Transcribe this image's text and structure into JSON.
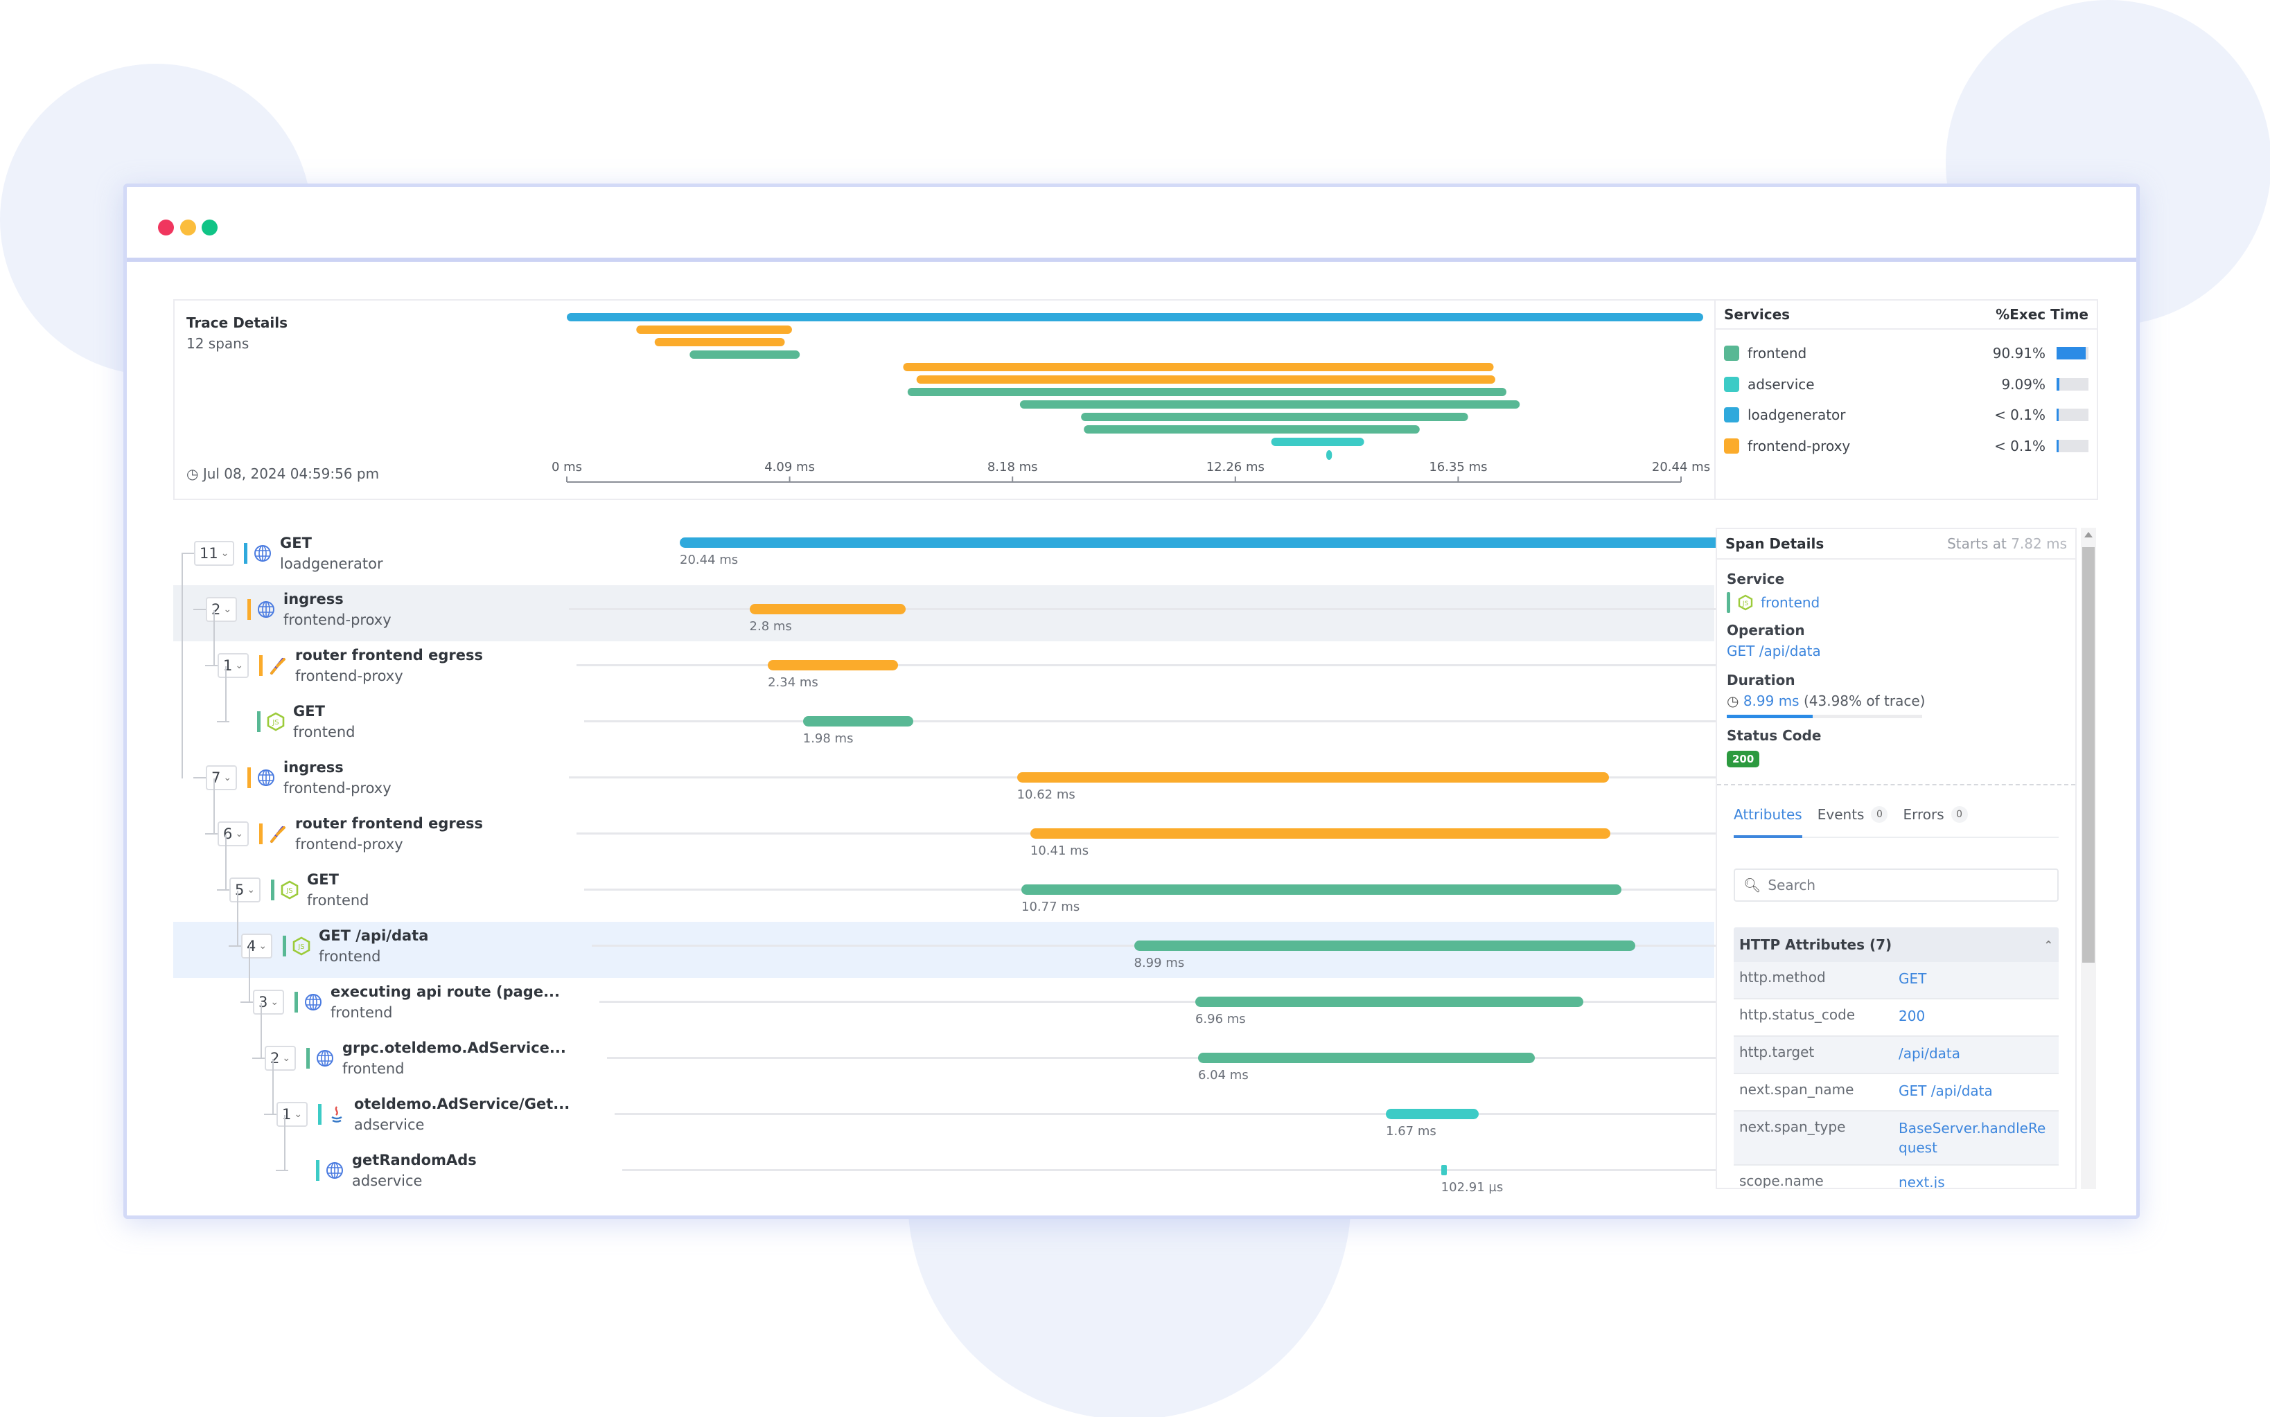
{
  "window": {
    "controls": [
      {
        "name": "close",
        "color": "#f0365e"
      },
      {
        "name": "minimize",
        "color": "#fbbd3c"
      },
      {
        "name": "maximize",
        "color": "#10c486"
      }
    ]
  },
  "trace": {
    "title": "Trace Details",
    "span_count": "12 spans",
    "timestamp": "Jul 08, 2024 04:59:56 pm",
    "total_ms": 20.44,
    "axis_ticks": [
      "0 ms",
      "4.09 ms",
      "8.18 ms",
      "12.26 ms",
      "16.35 ms",
      "20.44 ms"
    ]
  },
  "services": {
    "header_name": "Services",
    "header_pct": "%Exec Time",
    "items": [
      {
        "name": "frontend",
        "color": "#58b894",
        "pct_label": "90.91%",
        "pct": 90.91
      },
      {
        "name": "adservice",
        "color": "#3ccbc6",
        "pct_label": "9.09%",
        "pct": 9.09
      },
      {
        "name": "loadgenerator",
        "color": "#2fa9dc",
        "pct_label": "< 0.1%",
        "pct": 0.1
      },
      {
        "name": "frontend-proxy",
        "color": "#fbab2b",
        "pct_label": "< 0.1%",
        "pct": 0.1
      }
    ]
  },
  "spans": [
    {
      "operation": "GET",
      "service": "loadgenerator",
      "children": "11",
      "depth": 0,
      "icon": "globe-icon",
      "start_ms": 0,
      "duration_ms": 20.44,
      "duration_label": "20.44 ms",
      "color": "#2fa9dc",
      "state": ""
    },
    {
      "operation": "ingress",
      "service": "frontend-proxy",
      "children": "2",
      "depth": 1,
      "icon": "globe-icon",
      "start_ms": 1.25,
      "duration_ms": 2.8,
      "duration_label": "2.8 ms",
      "color": "#fbab2b",
      "state": "hover"
    },
    {
      "operation": "router frontend egress",
      "service": "frontend-proxy",
      "children": "1",
      "depth": 2,
      "icon": "envoy-icon",
      "start_ms": 1.58,
      "duration_ms": 2.34,
      "duration_label": "2.34 ms",
      "color": "#fbab2b",
      "state": ""
    },
    {
      "operation": "GET",
      "service": "frontend",
      "children": "",
      "depth": 3,
      "icon": "nodejs-icon",
      "start_ms": 2.21,
      "duration_ms": 1.98,
      "duration_label": "1.98 ms",
      "color": "#58b894",
      "state": ""
    },
    {
      "operation": "ingress",
      "service": "frontend-proxy",
      "children": "7",
      "depth": 1,
      "icon": "globe-icon",
      "start_ms": 6.05,
      "duration_ms": 10.62,
      "duration_label": "10.62 ms",
      "color": "#fbab2b",
      "state": ""
    },
    {
      "operation": "router frontend egress",
      "service": "frontend-proxy",
      "children": "6",
      "depth": 2,
      "icon": "envoy-icon",
      "start_ms": 6.29,
      "duration_ms": 10.41,
      "duration_label": "10.41 ms",
      "color": "#fbab2b",
      "state": ""
    },
    {
      "operation": "GET",
      "service": "frontend",
      "children": "5",
      "depth": 3,
      "icon": "nodejs-icon",
      "start_ms": 6.13,
      "duration_ms": 10.77,
      "duration_label": "10.77 ms",
      "color": "#58b894",
      "state": ""
    },
    {
      "operation": "GET /api/data",
      "service": "frontend",
      "children": "4",
      "depth": 4,
      "icon": "nodejs-icon",
      "start_ms": 8.15,
      "duration_ms": 8.99,
      "duration_label": "8.99 ms",
      "color": "#58b894",
      "state": "selected"
    },
    {
      "operation": "executing api route (page...",
      "service": "frontend",
      "children": "3",
      "depth": 5,
      "icon": "globe-icon",
      "start_ms": 9.25,
      "duration_ms": 6.96,
      "duration_label": "6.96 ms",
      "color": "#58b894",
      "state": ""
    },
    {
      "operation": "grpc.oteldemo.AdService...",
      "service": "frontend",
      "children": "2",
      "depth": 6,
      "icon": "globe-icon",
      "start_ms": 9.3,
      "duration_ms": 6.04,
      "duration_label": "6.04 ms",
      "color": "#58b894",
      "state": ""
    },
    {
      "operation": "oteldemo.AdService/Get...",
      "service": "adservice",
      "children": "1",
      "depth": 7,
      "icon": "java-icon",
      "start_ms": 12.67,
      "duration_ms": 1.67,
      "duration_label": "1.67 ms",
      "color": "#3ccbc6",
      "state": ""
    },
    {
      "operation": "getRandomAds",
      "service": "adservice",
      "children": "",
      "depth": 8,
      "icon": "globe-icon",
      "start_ms": 13.66,
      "duration_ms": 0.103,
      "duration_label": "102.91 µs",
      "color": "#3ccbc6",
      "state": ""
    }
  ],
  "span_details": {
    "title": "Span Details",
    "starts_prefix": "Starts at",
    "starts_value": "7.82 ms",
    "service_label": "Service",
    "service_value": "frontend",
    "service_color": "#58b894",
    "operation_label": "Operation",
    "operation_value": "GET /api/data",
    "duration_label": "Duration",
    "duration_value": "8.99 ms",
    "duration_pct_text": "(43.98% of trace)",
    "duration_pct": 43.98,
    "status_label": "Status Code",
    "status_value": "200",
    "tabs": [
      {
        "label": "Attributes",
        "count": "",
        "active": true
      },
      {
        "label": "Events",
        "count": "0",
        "active": false
      },
      {
        "label": "Errors",
        "count": "0",
        "active": false
      }
    ],
    "search_placeholder": "Search",
    "attr_group_title": "HTTP Attributes (7)",
    "attributes": [
      {
        "key": "http.method",
        "value": "GET"
      },
      {
        "key": "http.status_code",
        "value": "200"
      },
      {
        "key": "http.target",
        "value": "/api/data"
      },
      {
        "key": "next.span_name",
        "value": "GET /api/data"
      },
      {
        "key": "next.span_type",
        "value": "BaseServer.handleRequest"
      },
      {
        "key": "scope.name",
        "value": "next.js"
      }
    ]
  }
}
